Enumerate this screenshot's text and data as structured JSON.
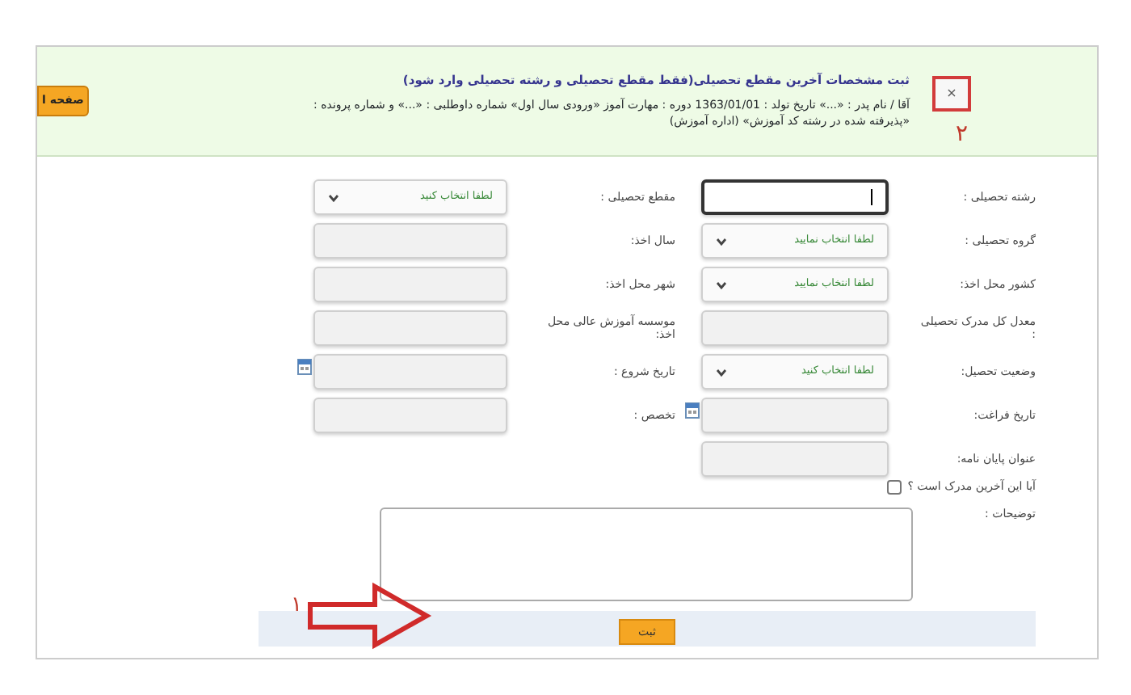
{
  "header": {
    "home_button": "صفحه ا",
    "title": "ثبت مشخصات آخرین مقطع تحصیلی(فقط مقطع تحصیلی و رشته تحصیلی وارد شود)",
    "info_lines": [
      "آقا / نام پدر : «...» تاریخ تولد : 1363/01/01 دوره : مهارت آموز «ورودی سال اول» شماره داوطلبی : «...» و شماره پرونده :",
      "«پذیرفته شده در رشته کد آموزش» (اداره آموزش)"
    ],
    "marker_box": "×"
  },
  "rows": [
    {
      "right": {
        "label": "رشته تحصیلی :",
        "kind": "text",
        "focused": true
      },
      "left": {
        "label": "مقطع تحصیلی :",
        "kind": "select",
        "value": "لطفا انتخاب کنید"
      }
    },
    {
      "right": {
        "label": "گروه تحصیلی :",
        "kind": "select",
        "value": "لطفا انتخاب نمایید"
      },
      "left": {
        "label": "سال اخذ:",
        "kind": "text",
        "focused": false
      }
    },
    {
      "right": {
        "label": "کشور محل اخذ:",
        "kind": "select",
        "value": "لطفا انتخاب نمایید"
      },
      "left": {
        "label": "شهر محل اخذ:",
        "kind": "text",
        "focused": false
      }
    },
    {
      "right": {
        "label": "معدل کل مدرک تحصیلی :",
        "kind": "text",
        "focused": false
      },
      "left": {
        "label": "موسسه آموزش عالی محل اخذ:",
        "kind": "text",
        "focused": false
      }
    },
    {
      "right": {
        "label": "وضعیت تحصیل:",
        "kind": "select",
        "value": "لطفا انتخاب کنید"
      },
      "left": {
        "label": "تاریخ شروع :",
        "kind": "date"
      }
    },
    {
      "right": {
        "label": "تاریخ فراغت:",
        "kind": "date"
      },
      "left": {
        "label": "تخصص :",
        "kind": "text",
        "focused": false
      }
    },
    {
      "right": {
        "label": "عنوان پایان نامه:",
        "kind": "text",
        "focused": false
      }
    }
  ],
  "last_degree": {
    "label": "آیا این آخرین مدرک است ؟",
    "checked": false
  },
  "notes": {
    "label": "توضیحات :"
  },
  "submit": "ثبت",
  "annotations": [
    {
      "kind": "box",
      "label": "۲"
    },
    {
      "kind": "arrow",
      "label": "۱"
    }
  ]
}
